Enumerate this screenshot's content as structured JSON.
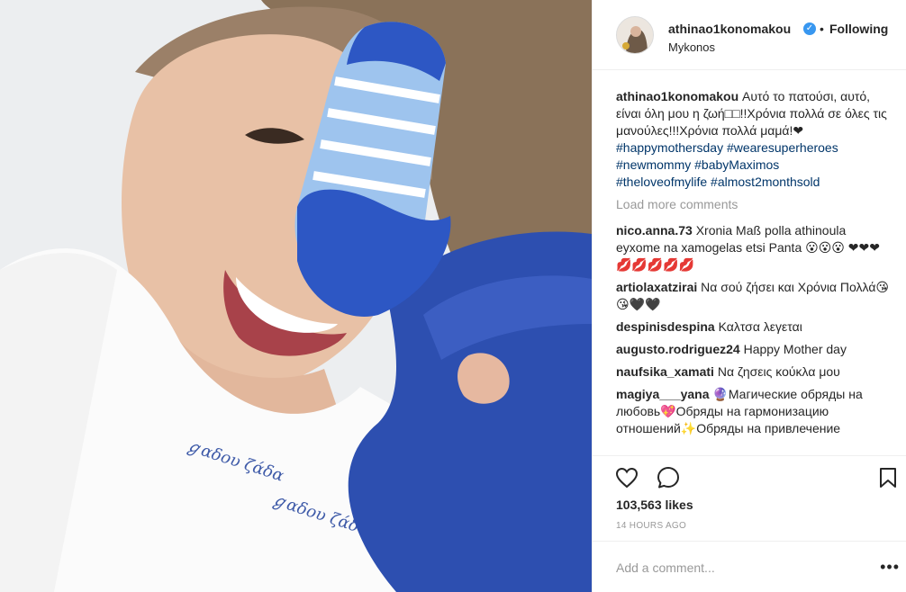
{
  "post": {
    "username": "athinao1konomakou",
    "following_label": "Following",
    "separator": "•",
    "location": "Mykonos",
    "verified_glyph": "✓"
  },
  "caption": {
    "username": "athinao1konomakou",
    "text": "Αυτό το πατούσι, αυτό, είναι όλη μου η ζωή□□!!Χρόνια πολλά σε όλες τις μανούλες!!!Χρόνια πολλά μαμά!❤",
    "hashtags_line1": "#happymothersday #wearesuperheroes",
    "hashtags_line2": "#newmommy #babyMaximos",
    "hashtags_line3": "#theloveofmylife #almost2monthsold"
  },
  "load_more_label": "Load more comments",
  "comments": [
    {
      "user": "nico.anna.73",
      "text": "Χronia Maß polla athinoula eyxome na xamogelas etsi Panta 😮😮😮 ❤❤❤💋💋💋💋💋"
    },
    {
      "user": "artiolaxatzirai",
      "text": "Να σού ζήσει και Χρόνια Πολλά😘😘🖤🖤"
    },
    {
      "user": "despinisdespina",
      "text": "Καλτσα λεγεται"
    },
    {
      "user": "augusto.rodriguez24",
      "text": "Happy Mother day"
    },
    {
      "user": "naufsika_xamati",
      "text": "Να ζησεις κούκλα μου"
    },
    {
      "user": "magiya___yana",
      "text": "🔮Магические обряды на любовь💖Обряды на гармонизацию отношений✨Обряды на привлечение"
    }
  ],
  "likes": "103,563 likes",
  "timestamp": "14 HOURS AGO",
  "add_comment": {
    "placeholder": "Add a comment..."
  },
  "more_glyph": "•••",
  "icons": {
    "like": "heart-icon",
    "comment": "comment-icon",
    "save": "bookmark-icon",
    "verified": "verified-badge-icon",
    "more": "more-options-icon"
  },
  "colors": {
    "text": "#262626",
    "muted": "#999999",
    "link": "#003569",
    "verified": "#3897f0",
    "border": "#efefef",
    "shirt_blue": "#2d4fb0"
  }
}
